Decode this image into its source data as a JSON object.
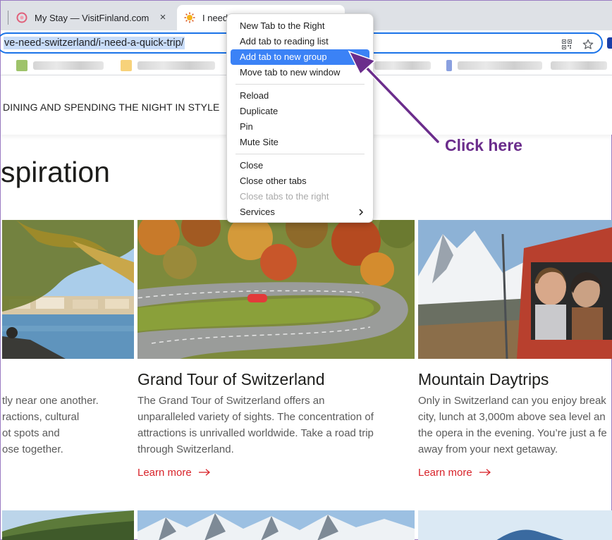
{
  "browser": {
    "tabs": [
      {
        "title": "My Stay — VisitFinland.com",
        "close": "×"
      },
      {
        "title": "I need a quick trip",
        "close": "×"
      }
    ],
    "url": "ve-need-switzerland/i-need-a-quick-trip/"
  },
  "site": {
    "nav_text": "DINING AND SPENDING THE NIGHT IN STYLE",
    "heading": "spiration",
    "learn_more": "Learn more",
    "cards": [
      {
        "title": "",
        "desc": [
          "tly near one another.",
          "ractions, cultural",
          "ot spots and",
          "ose together."
        ]
      },
      {
        "title": "Grand Tour of Switzerland",
        "desc": [
          "The Grand Tour of Switzerland offers an",
          "unparalleled variety of sights. The concentration of",
          "attractions is unrivalled worldwide. Take a road trip",
          "through Switzerland."
        ]
      },
      {
        "title": "Mountain Daytrips",
        "desc": [
          "Only in Switzerland can you enjoy break",
          "city, lunch at 3,000m above sea level an",
          "the opera in the evening. You’re just a fe",
          "away from your next getaway."
        ]
      }
    ]
  },
  "context_menu": {
    "groups": [
      [
        {
          "label": "New Tab to the Right"
        },
        {
          "label": "Add tab to reading list"
        },
        {
          "label": "Add tab to new group",
          "highlighted": true
        },
        {
          "label": "Move tab to new window"
        }
      ],
      [
        {
          "label": "Reload"
        },
        {
          "label": "Duplicate"
        },
        {
          "label": "Pin"
        },
        {
          "label": "Mute Site"
        }
      ],
      [
        {
          "label": "Close"
        },
        {
          "label": "Close other tabs"
        },
        {
          "label": "Close tabs to the right",
          "disabled": true
        },
        {
          "label": "Services",
          "submenu": true
        }
      ]
    ]
  },
  "annotation": {
    "text": "Click here",
    "color": "#6b2d8c"
  },
  "colors": {
    "accent": "#1a73e8",
    "highlight": "#3b82f6",
    "link": "#d8232a"
  }
}
